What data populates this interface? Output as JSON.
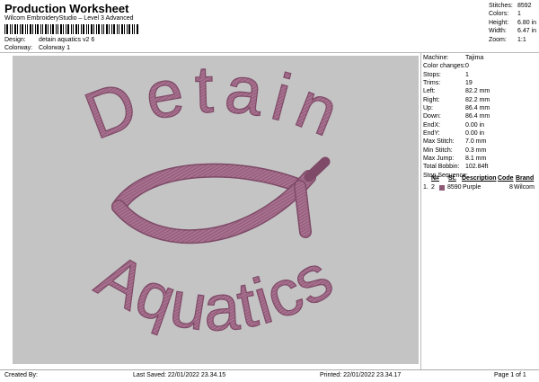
{
  "header": {
    "title": "Production Worksheet",
    "subtitle": "Wilcom EmbroideryStudio – Level 3 Advanced"
  },
  "meta": {
    "design_label": "Design:",
    "design_value": "detain aquatics v2 6",
    "colorway_label": "Colorway:",
    "colorway_value": "Colorway 1"
  },
  "stats": [
    {
      "label": "Stitches:",
      "value": "8592"
    },
    {
      "label": "Colors:",
      "value": "1"
    },
    {
      "label": "Height:",
      "value": "6.80 in"
    },
    {
      "label": "Width:",
      "value": "6.47 in"
    },
    {
      "label": "Zoom:",
      "value": "1:1"
    }
  ],
  "design": {
    "top_text": "Detain",
    "bottom_text": "Aquatics",
    "thread_color": "#a8718f",
    "thread_dark": "#7e4a67",
    "background": "#c4c4c4"
  },
  "machine_info": [
    {
      "label": "Machine:",
      "value": "Tajima"
    },
    {
      "label": "Color changes:",
      "value": "0"
    },
    {
      "label": "Stops:",
      "value": "1"
    },
    {
      "label": "Trims:",
      "value": "19"
    },
    {
      "label": "Left:",
      "value": "82.2 mm"
    },
    {
      "label": "Right:",
      "value": "82.2 mm"
    },
    {
      "label": "Up:",
      "value": "86.4 mm"
    },
    {
      "label": "Down:",
      "value": "86.4 mm"
    },
    {
      "label": "EndX:",
      "value": "0.00 in"
    },
    {
      "label": "EndY:",
      "value": "0.00 in"
    },
    {
      "label": "Max Stitch:",
      "value": "7.0 mm"
    },
    {
      "label": "Min Stitch:",
      "value": "0.3 mm"
    },
    {
      "label": "Max Jump:",
      "value": "8.1 mm"
    },
    {
      "label": "Total Bobbin:",
      "value": "102.84ft"
    }
  ],
  "stop_sequence": {
    "title": "Stop Sequence:",
    "headers": {
      "n": "N#",
      "st": "St.",
      "desc": "Description",
      "code": "Code",
      "brand": "Brand"
    },
    "rows": [
      {
        "idx": "1.",
        "n": "2",
        "st": "8590",
        "desc": "Purple",
        "code": "8",
        "brand": "Wilcom"
      }
    ]
  },
  "footer": {
    "created_by": "Created By:",
    "last_saved": "Last Saved: 22/01/2022 23.34.15",
    "printed": "Printed: 22/01/2022 23.34.17",
    "page": "Page 1 of 1"
  }
}
